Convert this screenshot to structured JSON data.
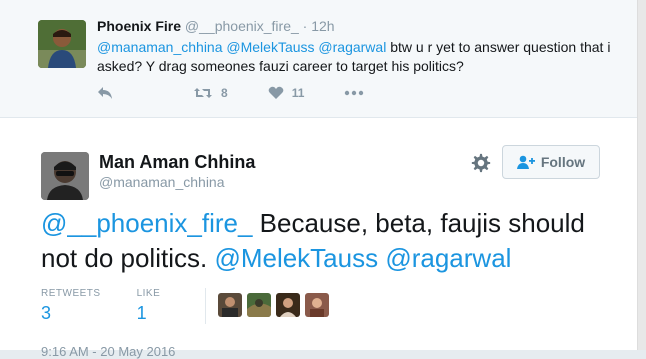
{
  "parent_tweet": {
    "name": "Phoenix Fire",
    "handle": "@__phoenix_fire_",
    "separator": "·",
    "time": "12h",
    "mentions": "@manaman_chhina @MelekTauss @ragarwal",
    "text": " btw u r yet to answer question that i asked? Y drag someones fauzi career to target his politics?",
    "retweet_count": "8",
    "like_count": "11",
    "icons": [
      "reply-icon",
      "retweet-icon",
      "heart-icon",
      "more-icon"
    ]
  },
  "main_tweet": {
    "name": "Man Aman Chhina",
    "handle": "@manaman_chhina",
    "follow_label": "Follow",
    "text_mention_start": "@__phoenix_fire_",
    "text_body": " Because, beta, faujis should not do politics. ",
    "text_mention_end": "@MelekTauss @ragarwal",
    "retweets_label": "RETWEETS",
    "retweets_value": "3",
    "likes_label": "LIKE",
    "likes_value": "1",
    "date": "9:16 AM - 20 May 2016",
    "icons": [
      "gear-icon",
      "follow-user-icon"
    ]
  },
  "colors": {
    "link": "#1b95e0",
    "muted": "#8899a6",
    "background": "#e6ecf0",
    "parent_background": "#f5f8fa"
  }
}
